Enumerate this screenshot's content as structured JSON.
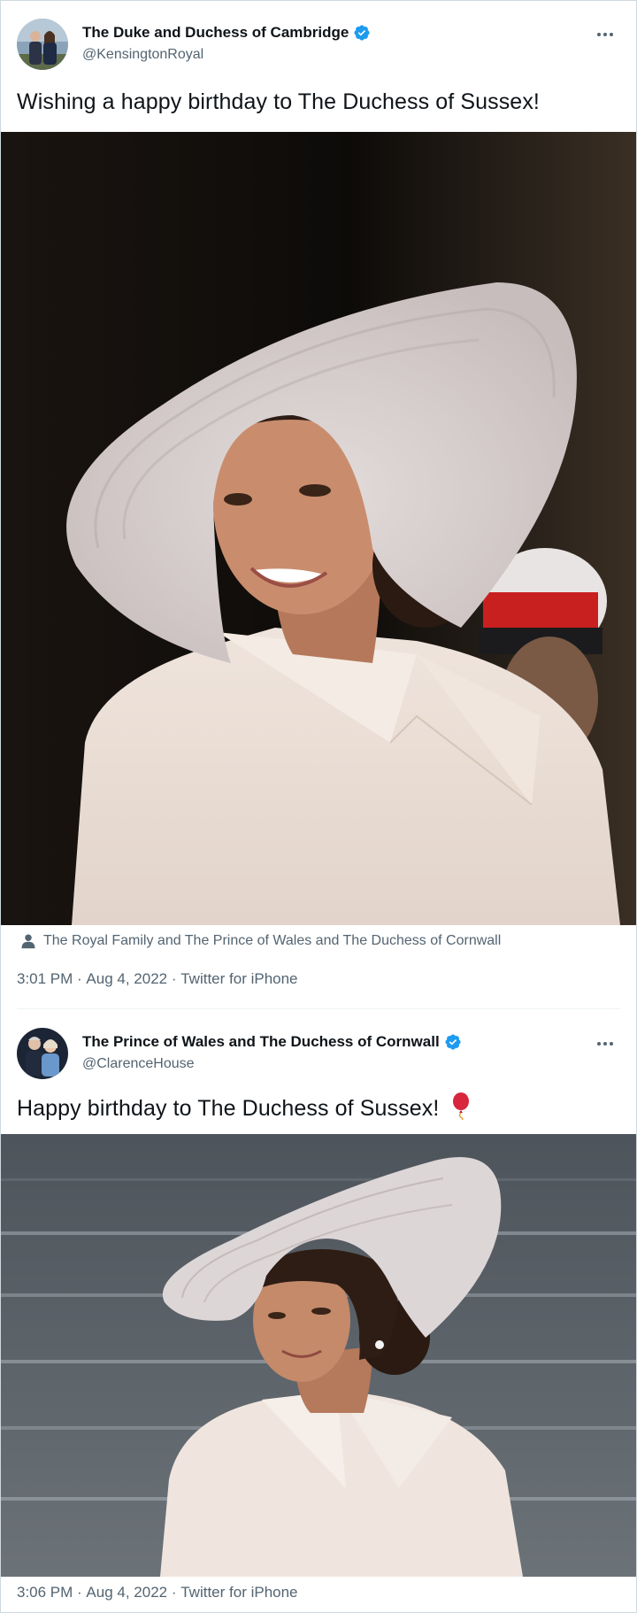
{
  "tweets": [
    {
      "author": {
        "display_name": "The Duke and Duchess of Cambridge",
        "handle": "@KensingtonRoyal",
        "verified": true
      },
      "text": "Wishing a happy birthday to The Duchess of Sussex!",
      "tagged": "The Royal Family and The Prince of Wales and The Duchess of Cornwall",
      "time": "3:01 PM",
      "date": "Aug 4, 2022",
      "source": "Twitter for iPhone",
      "separator": " · "
    },
    {
      "author": {
        "display_name": "The Prince of Wales and The Duchess of Cornwall",
        "handle": "@ClarenceHouse",
        "verified": true
      },
      "text": "Happy birthday to The Duchess of Sussex!",
      "emoji": "🎈",
      "time": "3:06 PM",
      "date": "Aug 4, 2022",
      "source": "Twitter for iPhone",
      "separator": " · "
    }
  ],
  "colors": {
    "text_primary": "#0f1419",
    "text_secondary": "#536471",
    "verified_blue": "#1d9bf0",
    "border": "#cfd9de"
  }
}
